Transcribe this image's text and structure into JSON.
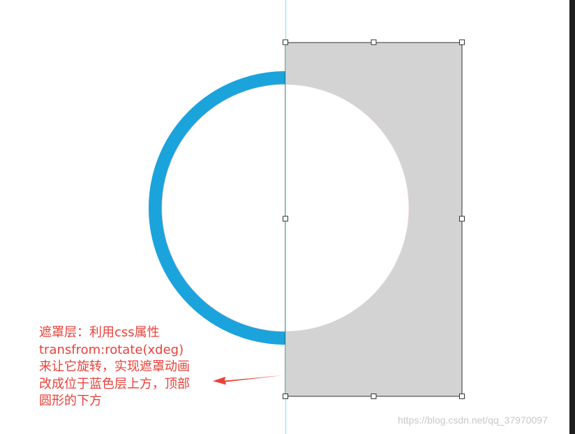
{
  "colors": {
    "ring": "#1ba3dc",
    "mask_fill": "#d3d3d3",
    "guide_line": "#7fe3ea",
    "annotation_text": "#e8413a",
    "arrow": "#e8413a",
    "watermark": "#c8c8c8"
  },
  "annotation": {
    "lines": [
      "遮罩层：利用css属性",
      "transfrom:rotate(xdeg)",
      "来让它旋转，实现遮罩动画",
      "改成位于蓝色层上方，顶部",
      "圆形的下方"
    ]
  },
  "watermark": "https://blog.csdn.net/qq_37970097"
}
